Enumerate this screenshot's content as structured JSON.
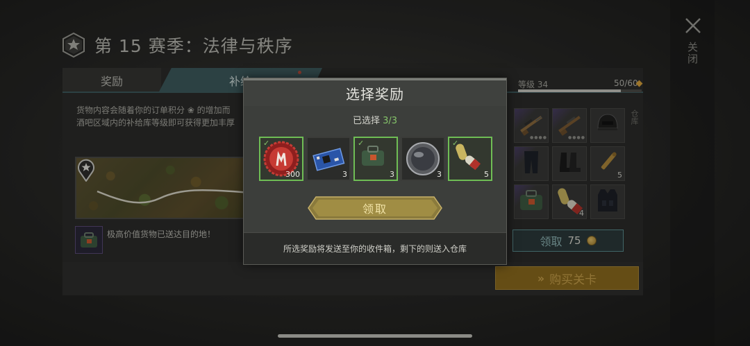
{
  "season": {
    "title": "第 15 赛季：法律与秩序"
  },
  "close": {
    "label": "关闭"
  },
  "tabs": [
    {
      "label": "奖励"
    },
    {
      "label": "补给"
    }
  ],
  "supply": {
    "description": "货物内容会随着你的订单积分 ❀ 的增加而\n酒吧区域内的补给库等级即可获得更加丰厚",
    "delivered_text": "极高价值货物已送达目的地！"
  },
  "level": {
    "label": "等级 34",
    "progress_text": "50/60",
    "progress_fraction": 0.83
  },
  "side_label": "仓库",
  "grid": [
    {
      "icon": "sniper-rifle-icon",
      "qty": "",
      "stars": "●●●●",
      "rarity": "purple"
    },
    {
      "icon": "shotgun-icon",
      "qty": "",
      "stars": "●●●●",
      "rarity": "purple"
    },
    {
      "icon": "helmet-icon",
      "qty": "",
      "stars": "",
      "rarity": "normal"
    },
    {
      "icon": "armor-pants-icon",
      "qty": "",
      "stars": "",
      "rarity": "purple"
    },
    {
      "icon": "boots-icon",
      "qty": "",
      "stars": "",
      "rarity": "normal"
    },
    {
      "icon": "rifle-ammo-icon",
      "qty": "5",
      "stars": "",
      "rarity": "normal"
    },
    {
      "icon": "supply-bag-icon",
      "qty": "",
      "stars": "",
      "rarity": "purple"
    },
    {
      "icon": "pills-icon",
      "qty": "4",
      "stars": "",
      "rarity": "normal"
    },
    {
      "icon": "tactical-vest-icon",
      "qty": "",
      "stars": "",
      "rarity": "normal"
    }
  ],
  "claim_cost": {
    "label": "领取",
    "value": "75"
  },
  "buy_pass": {
    "label": "购买关卡"
  },
  "modal": {
    "title": "选择奖励",
    "selected_prefix": "已选择 ",
    "selected_count": "3/3",
    "rewards": [
      {
        "icon": "bottle-cap-icon",
        "qty": "300",
        "selected": true
      },
      {
        "icon": "circuit-board-icon",
        "qty": "3",
        "selected": false
      },
      {
        "icon": "supply-bag-icon",
        "qty": "3",
        "selected": true
      },
      {
        "icon": "lens-icon",
        "qty": "3",
        "selected": false
      },
      {
        "icon": "pills-icon",
        "qty": "5",
        "selected": true
      }
    ],
    "claim_label": "领取",
    "footer": "所选奖励将发送至你的收件箱，剩下的则送入仓库"
  },
  "colors": {
    "accent_teal": "#3d5a5e",
    "selected_green": "#6fbe55",
    "gold": "#b59a45"
  }
}
